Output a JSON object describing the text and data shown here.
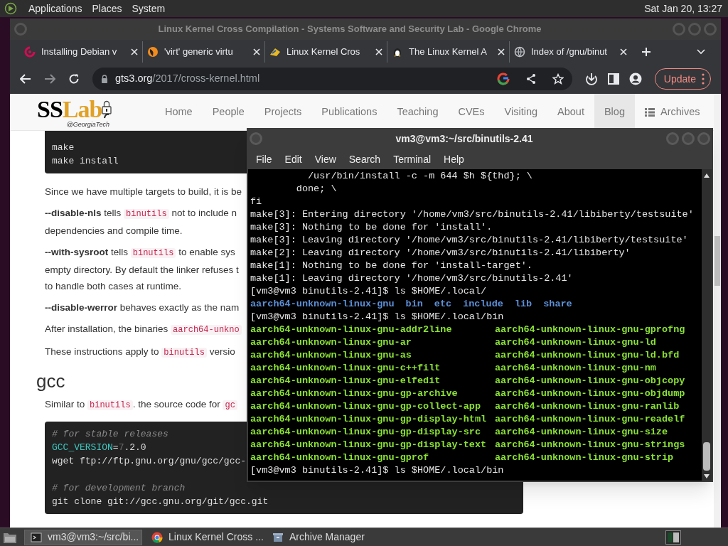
{
  "top_panel": {
    "menus": [
      "Applications",
      "Places",
      "System"
    ],
    "clock": "Sat Jan 20, 13:27"
  },
  "browser": {
    "title": "Linux Kernel Cross Compilation - Systems Software and Security Lab - Google Chrome",
    "tabs": [
      {
        "title": "Installing Debian v",
        "kind": "debian"
      },
      {
        "title": "'virt' generic virtu",
        "kind": "virt"
      },
      {
        "title": "Linux Kernel Cros",
        "kind": "lab"
      },
      {
        "title": "The Linux Kernel A",
        "kind": "tux"
      },
      {
        "title": "Index of /gnu/binut",
        "kind": "globe"
      }
    ],
    "address": {
      "host": "gts3.org",
      "path": "/2017/cross-kernel.html"
    },
    "update_button": "Update"
  },
  "site": {
    "logo": {
      "first": "SS",
      "second": "Lab",
      "tagline": "@GeorgiaTech"
    },
    "nav": [
      {
        "label": "Home",
        "selected": false,
        "kind": "text"
      },
      {
        "label": "People",
        "selected": false,
        "kind": "text"
      },
      {
        "label": "Projects",
        "selected": false,
        "kind": "text"
      },
      {
        "label": "Publications",
        "selected": false,
        "kind": "text"
      },
      {
        "label": "Teaching",
        "selected": false,
        "kind": "text"
      },
      {
        "label": "CVEs",
        "selected": false,
        "kind": "text"
      },
      {
        "label": "Visiting",
        "selected": false,
        "kind": "text"
      },
      {
        "label": "About",
        "selected": false,
        "kind": "text"
      },
      {
        "label": "Blog",
        "selected": true,
        "kind": "text"
      },
      {
        "label": "Archives",
        "selected": false,
        "kind": "list"
      }
    ],
    "content": [
      {
        "kind": "code",
        "groups": [
          [
            [
              {
                "kind": "plain",
                "text": "make"
              }
            ],
            [
              {
                "kind": "plain",
                "text": "make install"
              }
            ]
          ]
        ]
      },
      {
        "kind": "paragraph",
        "lines": [
          [
            {
              "kind": "text",
              "text": "Since we have multiple targets to build, it is be"
            }
          ]
        ]
      },
      {
        "kind": "paragraph",
        "lines": [
          [
            {
              "kind": "bold",
              "text": "--disable-nls"
            },
            {
              "kind": "text",
              "text": " tells "
            },
            {
              "kind": "code",
              "text": "binutils"
            },
            {
              "kind": "text",
              "text": " not to include n"
            }
          ],
          [
            {
              "kind": "text",
              "text": "dependencies and compile time."
            }
          ]
        ]
      },
      {
        "kind": "paragraph",
        "lines": [
          [
            {
              "kind": "bold",
              "text": "--with-sysroot"
            },
            {
              "kind": "text",
              "text": " tells "
            },
            {
              "kind": "code",
              "text": "binutils"
            },
            {
              "kind": "text",
              "text": " to enable sys"
            }
          ],
          [
            {
              "kind": "text",
              "text": "empty directory. By default the linker refuses t"
            }
          ],
          [
            {
              "kind": "text",
              "text": "to handle both cases at runtime."
            }
          ]
        ]
      },
      {
        "kind": "paragraph",
        "lines": [
          [
            {
              "kind": "bold",
              "text": "--disable-werror"
            },
            {
              "kind": "text",
              "text": " behaves exactly as the nam"
            }
          ]
        ]
      },
      {
        "kind": "paragraph",
        "lines": [
          [
            {
              "kind": "text",
              "text": "After installation, the binaries "
            },
            {
              "kind": "code",
              "text": "aarch64-unkno"
            }
          ]
        ]
      },
      {
        "kind": "paragraph",
        "lines": [
          [
            {
              "kind": "text",
              "text": "These instructions apply to "
            },
            {
              "kind": "code",
              "text": "binutils"
            },
            {
              "kind": "text",
              "text": " versio"
            }
          ]
        ]
      },
      {
        "kind": "heading",
        "text": "gcc"
      },
      {
        "kind": "paragraph",
        "lines": [
          [
            {
              "kind": "text",
              "text": "Similar to "
            },
            {
              "kind": "code",
              "text": "binutils"
            },
            {
              "kind": "text",
              "text": ". the source code for "
            },
            {
              "kind": "code",
              "text": "gc"
            }
          ]
        ]
      },
      {
        "kind": "code",
        "groups": [
          [
            [
              {
                "kind": "comment",
                "text": "# for stable releases"
              }
            ],
            [
              {
                "kind": "variable",
                "text": "GCC_VERSION"
              },
              {
                "kind": "plain",
                "text": "="
              },
              {
                "kind": "dim",
                "text": "7"
              },
              {
                "kind": "plain",
                "text": ".2.0"
              }
            ],
            [
              {
                "kind": "plain",
                "text": "wget ftp://ftp.gnu.org/gnu/gcc/gcc-"
              }
            ]
          ],
          [
            [
              {
                "kind": "comment",
                "text": "# for development branch"
              }
            ],
            [
              {
                "kind": "plain",
                "text": "git clone git://gcc.gnu.org/git/gcc.git"
              }
            ]
          ]
        ]
      }
    ]
  },
  "terminal": {
    "title": "vm3@vm3:~/src/binutils-2.41",
    "menus": [
      "File",
      "Edit",
      "View",
      "Search",
      "Terminal",
      "Help"
    ],
    "lines": [
      {
        "kind": "text",
        "text": "          /usr/bin/install -c -m 644 $h ${thd}; \\"
      },
      {
        "kind": "text",
        "text": "        done; \\"
      },
      {
        "kind": "text",
        "text": "fi"
      },
      {
        "kind": "text",
        "text": "make[3]: Entering directory '/home/vm3/src/binutils-2.41/libiberty/testsuite'"
      },
      {
        "kind": "text",
        "text": "make[3]: Nothing to be done for 'install'."
      },
      {
        "kind": "text",
        "text": "make[3]: Leaving directory '/home/vm3/src/binutils-2.41/libiberty/testsuite'"
      },
      {
        "kind": "text",
        "text": "make[2]: Leaving directory '/home/vm3/src/binutils-2.41/libiberty'"
      },
      {
        "kind": "text",
        "text": "make[1]: Nothing to be done for 'install-target'."
      },
      {
        "kind": "text",
        "text": "make[1]: Leaving directory '/home/vm3/src/binutils-2.41'"
      },
      {
        "kind": "text",
        "text": "[vm3@vm3 binutils-2.41]$ ls $HOME/.local/"
      },
      {
        "kind": "dirs",
        "items": [
          "aarch64-unknown-linux-gnu",
          "bin",
          "etc",
          "include",
          "lib",
          "share"
        ]
      },
      {
        "kind": "text",
        "text": "[vm3@vm3 binutils-2.41]$ ls $HOME/.local/bin"
      },
      {
        "kind": "files",
        "items": [
          "aarch64-unknown-linux-gnu-addr2line",
          "aarch64-unknown-linux-gnu-gprofng"
        ]
      },
      {
        "kind": "files",
        "items": [
          "aarch64-unknown-linux-gnu-ar",
          "aarch64-unknown-linux-gnu-ld"
        ]
      },
      {
        "kind": "files",
        "items": [
          "aarch64-unknown-linux-gnu-as",
          "aarch64-unknown-linux-gnu-ld.bfd"
        ]
      },
      {
        "kind": "files",
        "items": [
          "aarch64-unknown-linux-gnu-c++filt",
          "aarch64-unknown-linux-gnu-nm"
        ]
      },
      {
        "kind": "files",
        "items": [
          "aarch64-unknown-linux-gnu-elfedit",
          "aarch64-unknown-linux-gnu-objcopy"
        ]
      },
      {
        "kind": "files",
        "items": [
          "aarch64-unknown-linux-gnu-gp-archive",
          "aarch64-unknown-linux-gnu-objdump"
        ]
      },
      {
        "kind": "files",
        "items": [
          "aarch64-unknown-linux-gnu-gp-collect-app",
          "aarch64-unknown-linux-gnu-ranlib"
        ]
      },
      {
        "kind": "files",
        "items": [
          "aarch64-unknown-linux-gnu-gp-display-html",
          "aarch64-unknown-linux-gnu-readelf"
        ]
      },
      {
        "kind": "files",
        "items": [
          "aarch64-unknown-linux-gnu-gp-display-src",
          "aarch64-unknown-linux-gnu-size"
        ]
      },
      {
        "kind": "files",
        "items": [
          "aarch64-unknown-linux-gnu-gp-display-text",
          "aarch64-unknown-linux-gnu-strings"
        ]
      },
      {
        "kind": "files",
        "items": [
          "aarch64-unknown-linux-gnu-gprof",
          "aarch64-unknown-linux-gnu-strip"
        ]
      },
      {
        "kind": "text",
        "text": "[vm3@vm3 binutils-2.41]$ ls $HOME/.local/bin"
      }
    ]
  },
  "taskbar": {
    "items": [
      {
        "label": "vm3@vm3:~/src/bi...",
        "kind": "terminal",
        "selected": true
      },
      {
        "label": "Linux Kernel Cross ...",
        "kind": "chrome",
        "selected": false
      },
      {
        "label": "Archive Manager",
        "kind": "archive",
        "selected": false
      }
    ]
  }
}
